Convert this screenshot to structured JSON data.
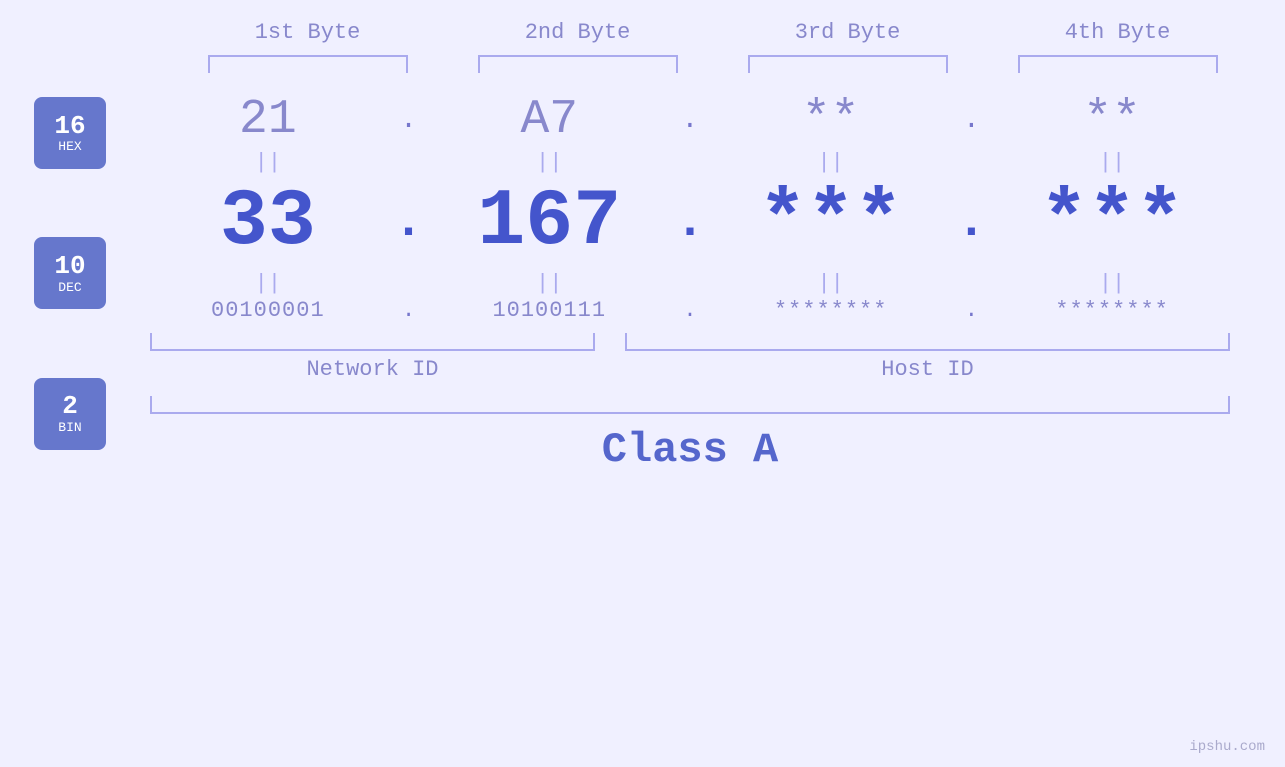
{
  "header": {
    "byte1_label": "1st Byte",
    "byte2_label": "2nd Byte",
    "byte3_label": "3rd Byte",
    "byte4_label": "4th Byte"
  },
  "badges": {
    "hex": {
      "number": "16",
      "label": "HEX"
    },
    "dec": {
      "number": "10",
      "label": "DEC"
    },
    "bin": {
      "number": "2",
      "label": "BIN"
    }
  },
  "rows": {
    "hex": {
      "b1": "21",
      "b2": "A7",
      "b3": "**",
      "b4": "**",
      "dot": "."
    },
    "dec": {
      "b1": "33",
      "b2": "167",
      "b3": "***",
      "b4": "***",
      "dot": "."
    },
    "bin": {
      "b1": "00100001",
      "b2": "10100111",
      "b3": "********",
      "b4": "********",
      "dot": "."
    }
  },
  "labels": {
    "network_id": "Network ID",
    "host_id": "Host ID"
  },
  "class_label": "Class A",
  "watermark": "ipshu.com",
  "equals_sign": "||"
}
